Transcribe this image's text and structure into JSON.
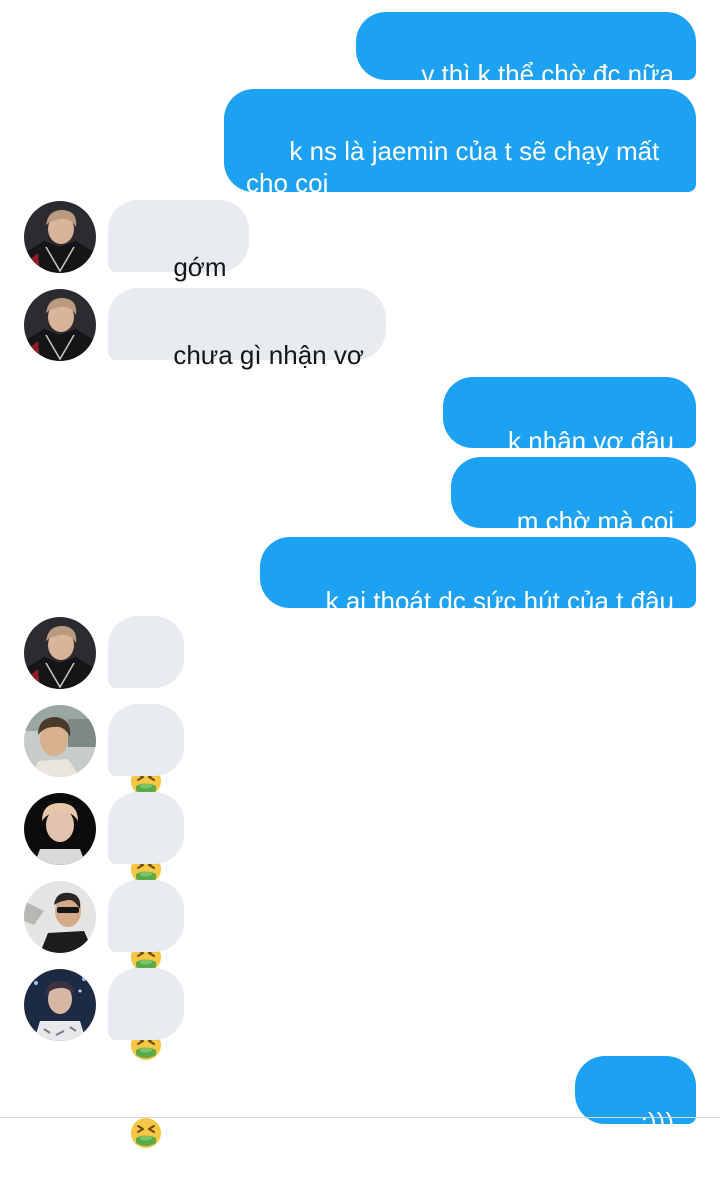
{
  "messages": [
    {
      "id": "m1",
      "side": "out",
      "text": "v thì k thể chờ đc nữa"
    },
    {
      "id": "m2",
      "side": "out",
      "text": "k ns là jaemin của t sẽ chạy mất\ncho coi"
    },
    {
      "id": "m3",
      "side": "in",
      "text": "gớm",
      "avatar": "avatar-red-jacket"
    },
    {
      "id": "m4",
      "side": "in",
      "text": "chưa gì nhận vơ",
      "avatar": "avatar-red-jacket"
    },
    {
      "id": "m5",
      "side": "out",
      "text": "k nhận vơ đâu"
    },
    {
      "id": "m6",
      "side": "out",
      "text": "m chờ mà coi"
    },
    {
      "id": "m7",
      "side": "out",
      "text": "k ai thoát dc sức hút của t đâu"
    },
    {
      "id": "m8",
      "side": "in",
      "emoji": "nauseated-face-emoji",
      "avatar": "avatar-red-jacket"
    },
    {
      "id": "m9",
      "side": "in",
      "emoji": "nauseated-face-emoji",
      "avatar": "avatar-outdoor"
    },
    {
      "id": "m10",
      "side": "in",
      "emoji": "nauseated-face-emoji",
      "avatar": "avatar-light-hair"
    },
    {
      "id": "m11",
      "side": "in",
      "emoji": "nauseated-face-emoji",
      "avatar": "avatar-sunglasses"
    },
    {
      "id": "m12",
      "side": "in",
      "emoji": "nauseated-face-emoji",
      "avatar": "avatar-night"
    },
    {
      "id": "m13",
      "side": "out",
      "text": ":)))"
    }
  ],
  "colors": {
    "outgoing_bubble": "#1da1f2",
    "incoming_bubble": "#e8ecf0",
    "incoming_text": "#14171a",
    "outgoing_text": "#ffffff"
  }
}
